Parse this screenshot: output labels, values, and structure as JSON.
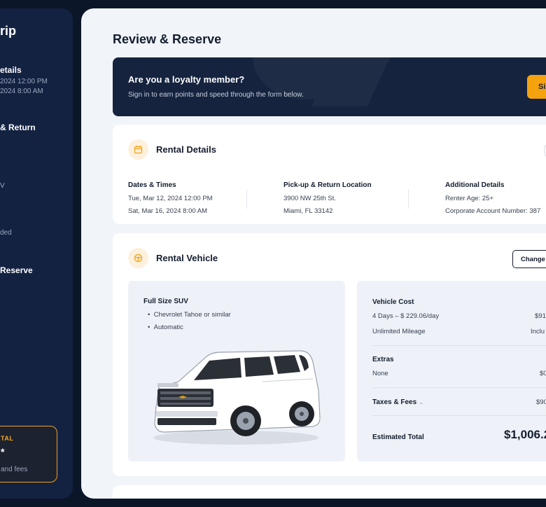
{
  "sidebar": {
    "title": "rip",
    "details_title": "etails",
    "details_lines": [
      "2024 12:00 PM",
      "2024 8:00 AM"
    ],
    "return_title": "& Return",
    "vehicle_line": "V",
    "extras_line": "ded",
    "reserve_title": "Reserve",
    "total_label": "TAL",
    "total_value": "*",
    "total_sub": "and fees"
  },
  "page": {
    "title": "Review & Reserve"
  },
  "banner": {
    "heading": "Are you a loyalty member?",
    "text": "Sign in to earn points and speed through the form below.",
    "button_label": "Si"
  },
  "rental_details": {
    "title": "Rental Details",
    "dates": {
      "label": "Dates & Times",
      "lines": [
        "Tue, Mar 12, 2024 12:00 PM",
        "Sat, Mar 16, 2024 8:00 AM"
      ]
    },
    "location": {
      "label": "Pick-up & Return Location",
      "lines": [
        "3900 NW 25th St.",
        "Miami, FL 33142"
      ]
    },
    "additional": {
      "label": "Additional Details",
      "lines": [
        "Renter Age: 25+",
        "Corporate Account Number: 387"
      ]
    }
  },
  "rental_vehicle": {
    "title": "Rental Vehicle",
    "change_button": "Change V",
    "vehicle_name": "Full Size SUV",
    "features": [
      "Chevrolet Tahoe or similar",
      "Automatic"
    ],
    "cost": {
      "title": "Vehicle Cost",
      "rate_label": "4 Days  –  $ 229.06/day",
      "rate_value": "$916",
      "mileage_label": "Unlimited Mileage",
      "mileage_value": "Inclu",
      "extras_title": "Extras",
      "extras_label": "None",
      "extras_value": "$0",
      "taxes_label": "Taxes & Fees",
      "taxes_value": "$90",
      "total_label": "Estimated Total",
      "total_value": "$1,006.2"
    }
  },
  "colors": {
    "accent": "#f5a20f",
    "navy": "#15233f",
    "panel": "#f1f4f9"
  }
}
